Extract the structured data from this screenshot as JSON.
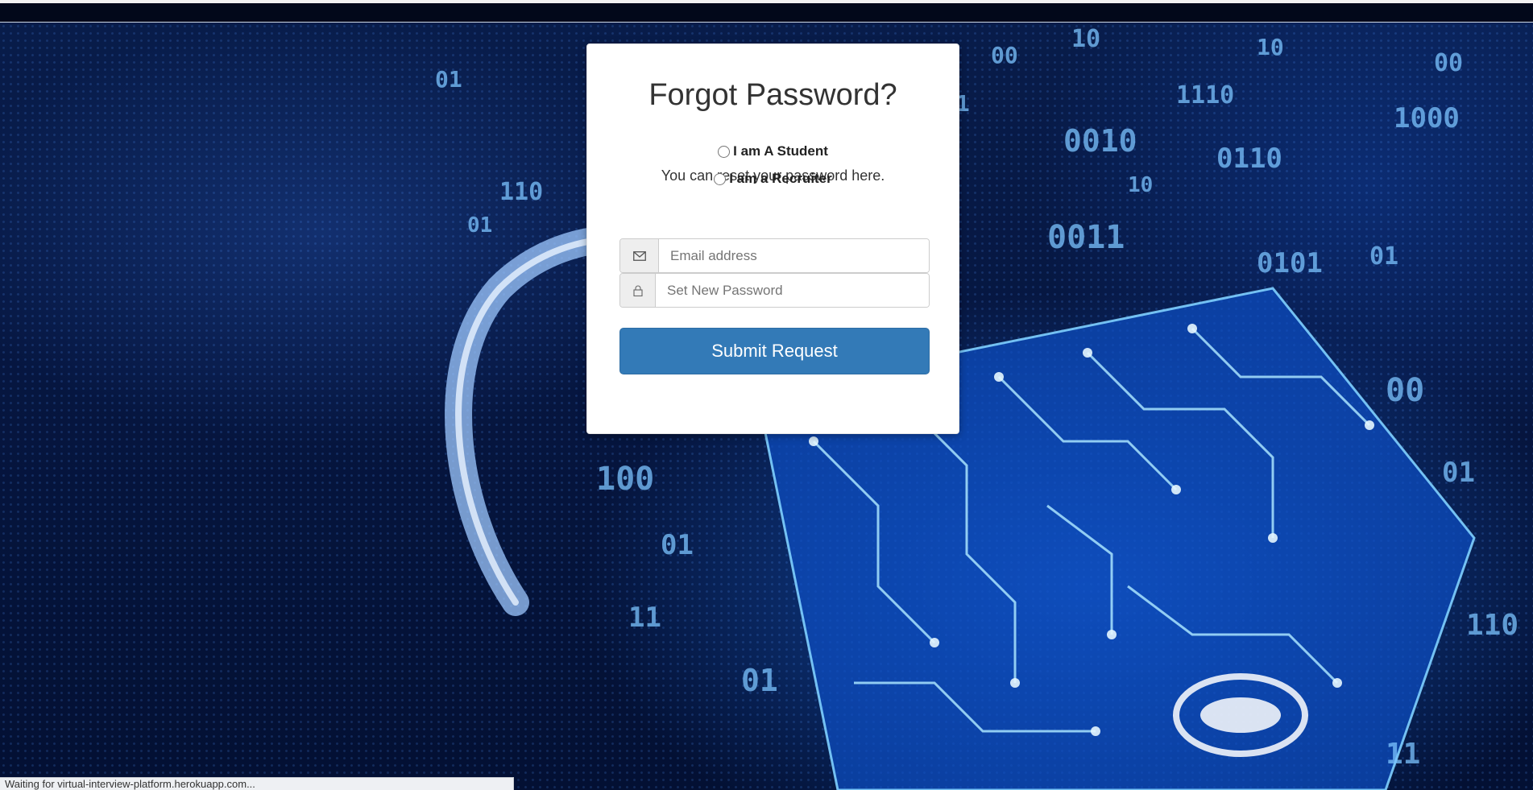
{
  "card": {
    "title": "Forgot Password?",
    "subtitle": "You can reset your password here.",
    "roles": [
      {
        "label": "I am A Student",
        "selected": false
      },
      {
        "label": "I am a Recruiter",
        "selected": false
      }
    ],
    "email": {
      "placeholder": "Email address",
      "icon": "envelope-icon"
    },
    "password": {
      "placeholder": "Set New Password",
      "icon": "lock-icon"
    },
    "submit_label": "Submit Request"
  },
  "status_bar": {
    "text": "Waiting for virtual-interview-platform.herokuapp.com..."
  },
  "colors": {
    "primary_button": "#337ab7",
    "card_background": "#ffffff"
  }
}
